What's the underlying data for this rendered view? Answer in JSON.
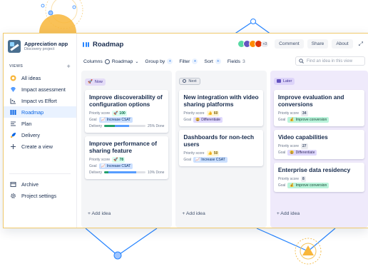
{
  "colors": {
    "accent": "#0c66e4",
    "frame_border": "#f0c96b",
    "later_column": "#efeafb",
    "progress_done": "#22a06b",
    "progress_in_progress": "#579dff"
  },
  "project": {
    "name": "Appreciation app",
    "subtitle": "Discovery project",
    "logo_icon": "project-logo-icon"
  },
  "sidebar": {
    "views_header": "VIEWS",
    "add_view_label": "+",
    "items": [
      {
        "label": "All ideas",
        "icon": "ideas-icon"
      },
      {
        "label": "Impact assessment",
        "icon": "diamond-icon"
      },
      {
        "label": "Impact vs Effort",
        "icon": "matrix-icon"
      },
      {
        "label": "Roadmap",
        "icon": "roadmap-icon",
        "active": true
      },
      {
        "label": "Plan",
        "icon": "plan-icon"
      },
      {
        "label": "Delivery",
        "icon": "rocket-icon"
      },
      {
        "label": "Create a view",
        "icon": "plus-icon"
      }
    ],
    "footer_items": [
      {
        "label": "Archive",
        "icon": "archive-icon"
      },
      {
        "label": "Project settings",
        "icon": "gear-icon"
      }
    ]
  },
  "header": {
    "title": "Roadmap",
    "avatar_overflow": "+3",
    "buttons": {
      "comment": "Comment",
      "share": "Share",
      "about": "About"
    },
    "expand_icon": "expand-icon"
  },
  "toolbar": {
    "columns_label": "Columns",
    "columns_value": "Roadmap",
    "group_by_label": "Group by",
    "filter_label": "Filter",
    "sort_label": "Sort",
    "fields_label": "Fields",
    "fields_count": "3",
    "add_symbol": "+",
    "search_placeholder": "Find an idea in this view"
  },
  "columns": [
    {
      "label": "Now",
      "add_label": "+ Add idea",
      "cards": [
        {
          "title": "Improve discoverability of configuration options",
          "priority_label": "Priority score",
          "score": "100",
          "score_style": "green",
          "goal_label": "Goal",
          "goal": "Increase CSAT",
          "goal_style": "blue",
          "delivery_label": "Delivery",
          "delivery_done_fraction": 0.25,
          "delivery_progress_fraction": 0.6,
          "delivery_text": "25% Done"
        },
        {
          "title": "Improve performance of sharing feature",
          "priority_label": "Priority score",
          "score": "78",
          "score_style": "green",
          "goal_label": "Goal",
          "goal": "Increase CSAT",
          "goal_style": "blue",
          "delivery_label": "Delivery",
          "delivery_done_fraction": 0.1,
          "delivery_progress_fraction": 0.78,
          "delivery_text": "10% Done"
        }
      ]
    },
    {
      "label": "Next",
      "add_label": "+ Add idea",
      "cards": [
        {
          "title": "New integration with video sharing platforms",
          "priority_label": "Priority score",
          "score": "60",
          "score_style": "yellow",
          "goal_label": "Goal",
          "goal": "Differentiate",
          "goal_style": "purple"
        },
        {
          "title": "Dashboards for non-tech users",
          "priority_label": "Priority score",
          "score": "50",
          "score_style": "yellow",
          "goal_label": "Goal",
          "goal": "Increase CSAT",
          "goal_style": "blue"
        }
      ]
    },
    {
      "label": "Later",
      "add_label": "+ Add idea",
      "cards": [
        {
          "title": "Improve evaluation and conversions",
          "priority_label": "Priority score",
          "score": "34",
          "score_style": "grey",
          "goal_label": "Goal",
          "goal": "Improve conversion",
          "goal_style": "green"
        },
        {
          "title": "Video capabilities",
          "priority_label": "Priority score",
          "score": "27",
          "score_style": "grey",
          "goal_label": "Goal",
          "goal": "Differentiate",
          "goal_style": "purple"
        },
        {
          "title": "Enterprise data residency",
          "priority_label": "Priority score",
          "score": "8",
          "score_style": "grey",
          "goal_label": "Goal",
          "goal": "Improve conversion",
          "goal_style": "green"
        }
      ]
    }
  ]
}
